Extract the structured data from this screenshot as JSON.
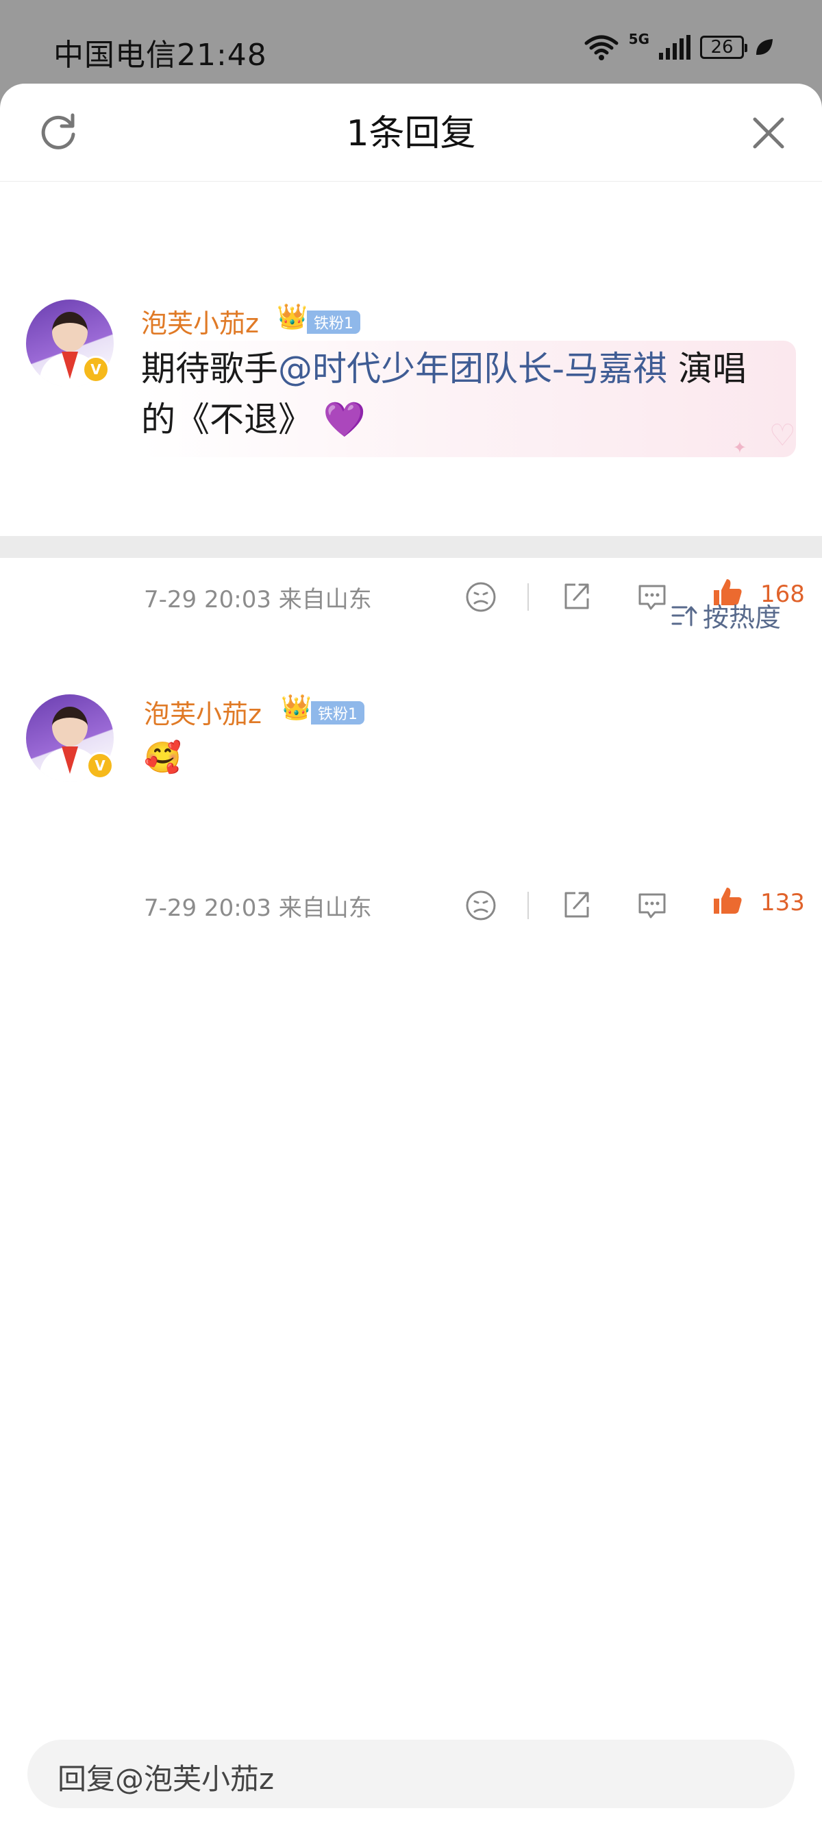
{
  "status_bar": {
    "carrier_time": "中国电信21:48",
    "network": "5G",
    "wifi_label": "6",
    "battery": "26"
  },
  "header": {
    "title": "1条回复"
  },
  "main_comment": {
    "username": "泡芙小茄z",
    "fan_badge": "铁粉1",
    "verified": "V",
    "text_prefix": "期待歌手",
    "mention": "@时代少年团队长-马嘉祺",
    "text_suffix": " 演唱的《不退》",
    "emoji": "💜",
    "timestamp": "7-29 20:03 来自山东",
    "likes": "168"
  },
  "sort": {
    "label": "按热度"
  },
  "replies": [
    {
      "username": "泡芙小茄z",
      "fan_badge": "铁粉1",
      "verified": "V",
      "emoji": "🥰",
      "timestamp": "7-29 20:03 来自山东",
      "likes": "133"
    }
  ],
  "reply_input": {
    "placeholder": "回复@泡芙小茄z"
  },
  "colors": {
    "username": "#e07a26",
    "mention": "#3f5c94",
    "likes": "#e0622a",
    "fan_badge": "#8fb8ea",
    "verified": "#f6b91b"
  }
}
